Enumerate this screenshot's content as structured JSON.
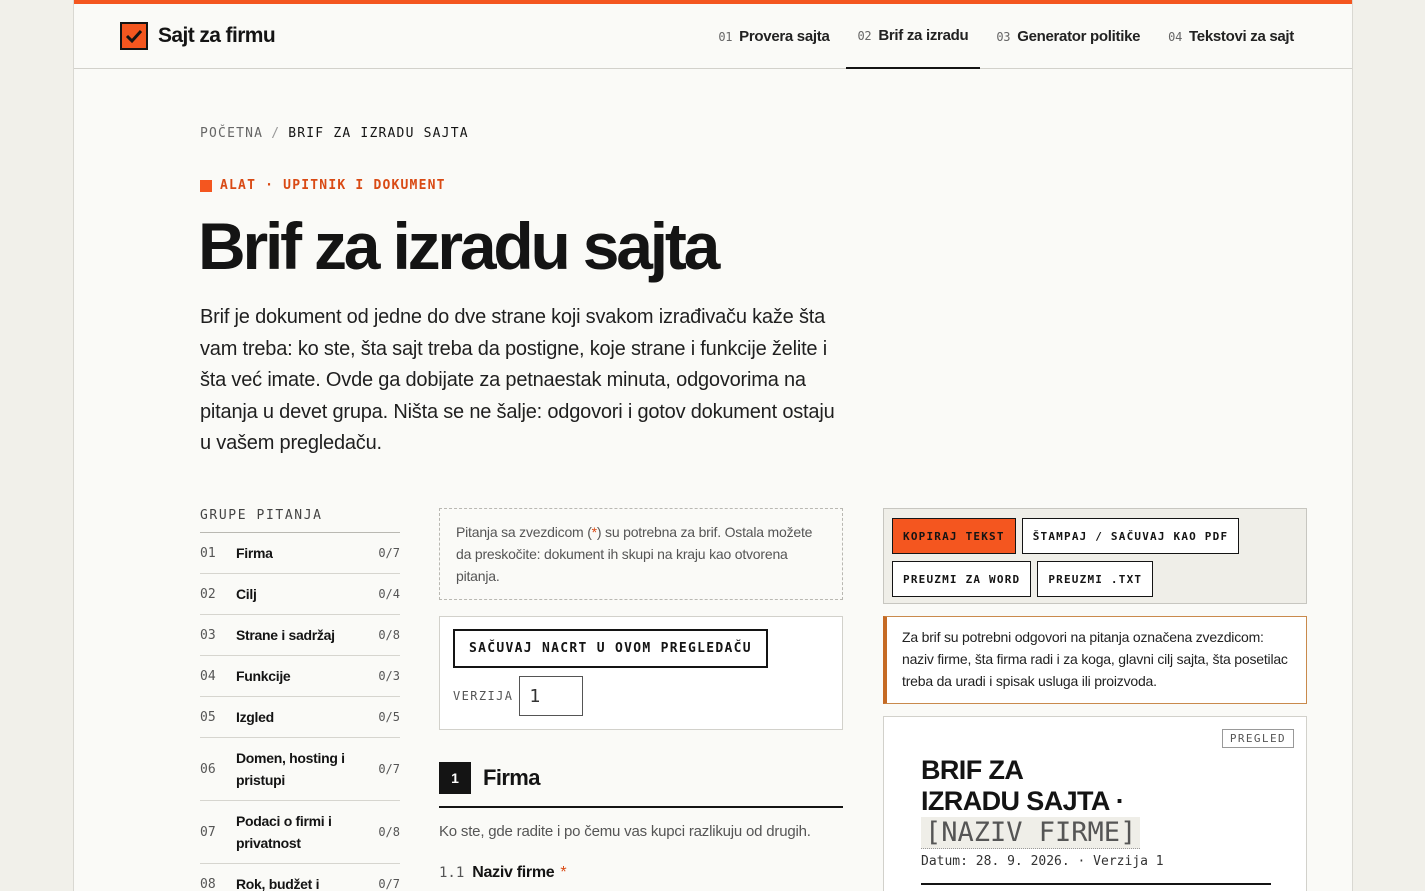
{
  "brand": {
    "name": "Sajt za firmu",
    "accent": "#f4561f"
  },
  "nav": [
    {
      "num": "01",
      "label": "Provera sajta",
      "active": false
    },
    {
      "num": "02",
      "label": "Brif za izradu",
      "active": true
    },
    {
      "num": "03",
      "label": "Generator politike",
      "active": false
    },
    {
      "num": "04",
      "label": "Tekstovi za sajt",
      "active": false
    }
  ],
  "breadcrumb": {
    "home": "POČETNA",
    "separator": "/",
    "current": "BRIF ZA IZRADU SAJTA"
  },
  "kicker": "ALAT · UPITNIK I DOKUMENT",
  "title": "Brif za izradu sajta",
  "lead": "Brif je dokument od jedne do dve strane koji svakom izrađivaču kaže šta vam treba: ko ste, šta sajt treba da postigne, koje strane i funkcije želite i šta već imate. Ovde ga dobijate za petnaestak minuta, odgovorima na pitanja u devet grupa. Ništa se ne šalje: odgovori i gotov dokument ostaju u vašem pregledaču.",
  "groups": {
    "heading": "GRUPE PITANJA",
    "items": [
      {
        "num": "01",
        "label": "Firma",
        "count": "0/7"
      },
      {
        "num": "02",
        "label": "Cilj",
        "count": "0/4"
      },
      {
        "num": "03",
        "label": "Strane i sadržaj",
        "count": "0/8"
      },
      {
        "num": "04",
        "label": "Funkcije",
        "count": "0/3"
      },
      {
        "num": "05",
        "label": "Izgled",
        "count": "0/5"
      },
      {
        "num": "06",
        "label": "Domen, hosting i pristupi",
        "count": "0/7"
      },
      {
        "num": "07",
        "label": "Podaci o firmi i privatnost",
        "count": "0/8"
      },
      {
        "num": "08",
        "label": "Rok, budžet i",
        "count": "0/7"
      }
    ]
  },
  "note": {
    "before": "Pitanja sa zvezdicom (",
    "star": "*",
    "after": ") su potrebna za brif. Ostala možete da preskočite: dokument ih skupi na kraju kao otvorena pitanja."
  },
  "draft": {
    "save_label": "SAČUVAJ NACRT U OVOM PREGLEDAČU",
    "version_label": "VERZIJA",
    "version_value": "1"
  },
  "section": {
    "num": "1",
    "title": "Firma",
    "desc": "Ko ste, gde radite i po čemu vas kupci razlikuju od drugih.",
    "question": {
      "num": "1.1",
      "label": "Naziv firme",
      "star": "*"
    }
  },
  "actions": {
    "copy": "KOPIRAJ TEKST",
    "print": "ŠTAMPAJ / SAČUVAJ KAO PDF",
    "word": "PREUZMI ZA WORD",
    "txt": "PREUZMI .TXT"
  },
  "warning": "Za brif su potrebni odgovori na pitanja označena zvezdicom: naziv firme, šta firma radi i za koga, glavni cilj sajta, šta posetilac treba da uradi i spisak usluga ili proizvoda.",
  "preview": {
    "badge": "PREGLED",
    "title_line1": "BRIF ZA",
    "title_line2": "IZRADU SAJTA ·",
    "placeholder": "[NAZIV FIRME]",
    "date": "Datum: 28. 9. 2026. · Verzija 1"
  }
}
